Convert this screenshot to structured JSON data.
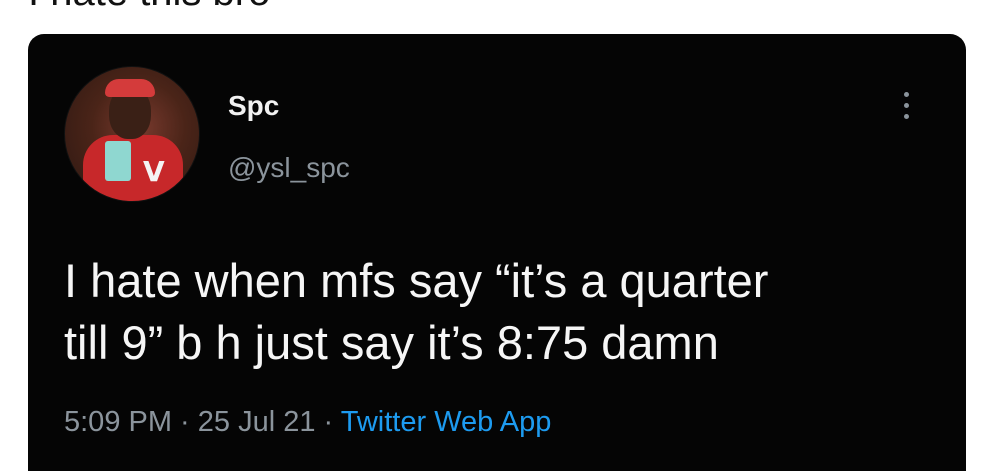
{
  "caption": "I hate this bro",
  "tweet": {
    "display_name": "Spc",
    "handle": "@ysl_spc",
    "text": "I hate when mfs say “it’s a quarter\ntill 9” b    h just say it’s 8:75 damn",
    "time": "5:09 PM",
    "separator_1": " · ",
    "date": "25 Jul 21",
    "separator_2": " · ",
    "source": "Twitter Web App"
  },
  "icons": {
    "avatar": "profile-photo",
    "more": "more-vertical-icon"
  },
  "colors": {
    "card_background": "#050505",
    "name_text": "#f2f2f2",
    "secondary_text": "#8b949c",
    "link_text": "#1d9bf0"
  }
}
